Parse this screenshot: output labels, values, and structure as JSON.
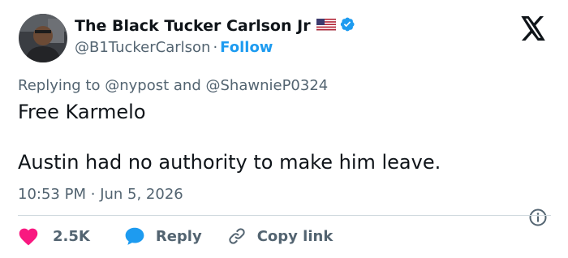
{
  "author": {
    "display_name": "The Black Tucker Carlson Jr",
    "handle": "@B1TuckerCarlson",
    "separator": "·",
    "follow_label": "Follow"
  },
  "reply_context": {
    "prefix": "Replying to",
    "mention_1": "@nypost",
    "conjunction": "and",
    "mention_2": "@ShawnieP0324"
  },
  "tweet": {
    "line_1": "Free Karmelo",
    "line_2": "Austin had no authority to make him leave."
  },
  "meta": {
    "time": "10:53 PM",
    "separator": "·",
    "date": "Jun 5, 2026"
  },
  "actions": {
    "like_count": "2.5K",
    "reply_label": "Reply",
    "copy_label": "Copy link"
  },
  "icons": {
    "like": "heart-icon",
    "reply": "speech-bubble-icon",
    "copy": "link-icon",
    "brand": "x-logo-icon",
    "info": "info-icon",
    "verified": "verified-badge-icon",
    "flag": "us-flag-icon"
  },
  "colors": {
    "text_primary": "#0f1419",
    "text_secondary": "#536471",
    "link_blue": "#1d9bf0",
    "like_red": "#f91880",
    "divider": "#cfd9de"
  }
}
